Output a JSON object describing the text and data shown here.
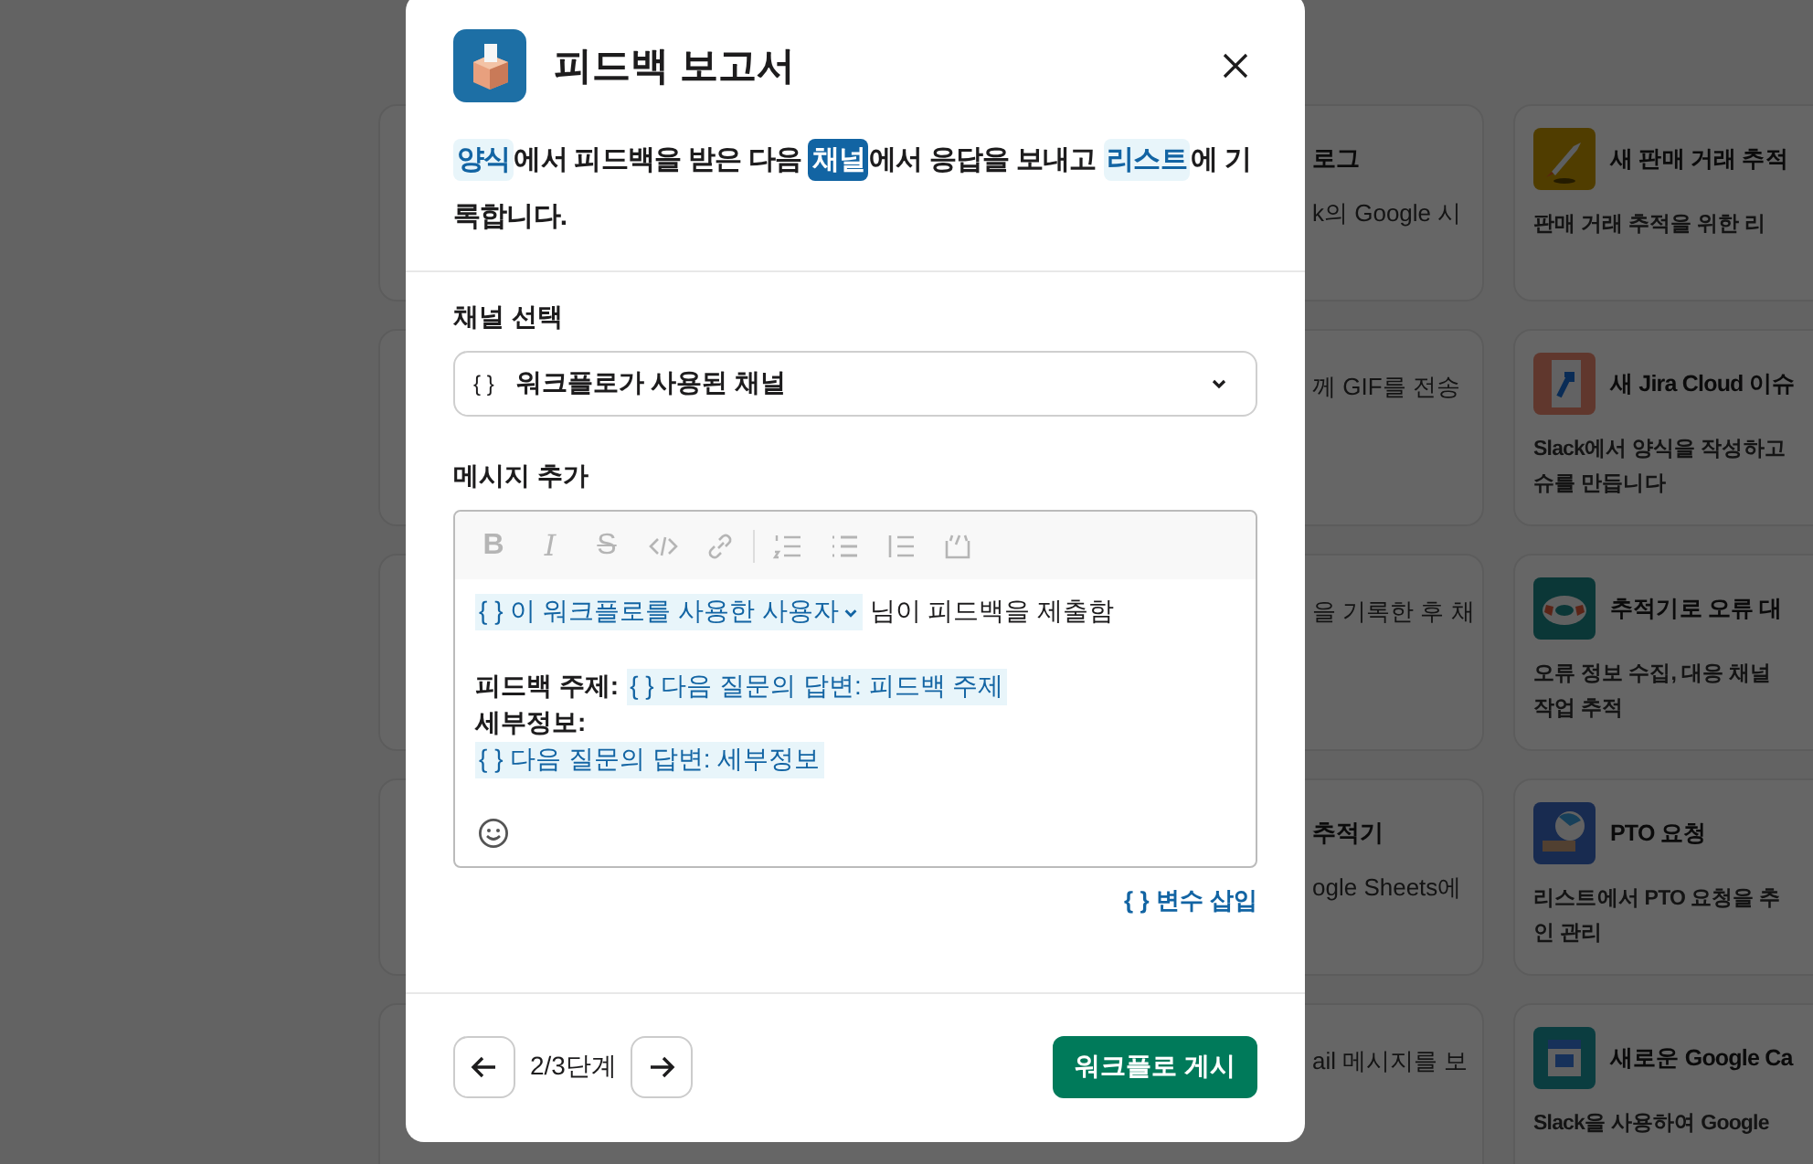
{
  "background_cards": {
    "column_1": [
      {
        "title": "로그",
        "description_lines": [
          "k의 Google 시"
        ]
      },
      {
        "description_lines": [
          "께 GIF를 전송"
        ]
      },
      {
        "description_lines": [
          "을 기록한 후 채"
        ]
      },
      {
        "title": "추적기",
        "description_lines": [
          "ogle Sheets에"
        ]
      },
      {
        "description_lines": [
          "ail 메시지를 보"
        ]
      }
    ],
    "column_2": [
      {
        "title": "새 판매 거래 추적",
        "description_lines": [
          "판매 거래 추적을 위한 리"
        ]
      },
      {
        "title": "새 Jira Cloud 이슈",
        "description_lines": [
          "Slack에서 양식을 작성하고",
          "슈를 만듭니다"
        ]
      },
      {
        "title": "추적기로 오류 대",
        "description_lines": [
          "오류 정보 수집, 대응 채널",
          "작업 추적"
        ]
      },
      {
        "title": "PTO 요청",
        "description_lines": [
          "리스트에서 PTO 요청을 추",
          "인 관리"
        ]
      },
      {
        "title": "새로운 Google Ca",
        "description_lines": [
          "Slack을 사용하여 Google"
        ]
      }
    ]
  },
  "dialog": {
    "title": "피드백 보고서",
    "summary": [
      {
        "kind": "token",
        "text": "양식"
      },
      {
        "kind": "plain",
        "text": "에서 피드백을 받은 다음 "
      },
      {
        "kind": "token_selected",
        "text": "채널"
      },
      {
        "kind": "plain",
        "text": "에서 응답을 보내고 "
      },
      {
        "kind": "token",
        "text": "리스트"
      },
      {
        "kind": "plain",
        "text": "에 기록합니다."
      }
    ],
    "channel_field": {
      "label": "채널 선택",
      "prefix": "{ }",
      "value": "워크플로가 사용된 채널"
    },
    "message_field": {
      "label": "메시지 추가",
      "toolbar": [
        {
          "kind": "bold",
          "glyph": "B"
        },
        {
          "kind": "italic",
          "glyph": "I"
        },
        {
          "kind": "strike",
          "glyph": "S"
        },
        {
          "kind": "code"
        },
        {
          "kind": "link"
        },
        {
          "kind": "divider"
        },
        {
          "kind": "numbered"
        },
        {
          "kind": "bulleted"
        },
        {
          "kind": "quote"
        },
        {
          "kind": "codeblock"
        }
      ],
      "lines": [
        {
          "segments": [
            {
              "kind": "variable",
              "text": "{ } 이 워크플로를 사용한 사용자",
              "dropdown": true
            },
            {
              "kind": "plain",
              "text": "님이 피드백을 제출함"
            }
          ]
        },
        {
          "gap_before": true,
          "segments": [
            {
              "kind": "bold",
              "text": "피드백 주제:"
            },
            {
              "kind": "variable",
              "text": "{ } 다음 질문의 답변: 피드백 주제",
              "dropdown": false
            }
          ]
        },
        {
          "segments": [
            {
              "kind": "bold",
              "text": "세부정보:"
            }
          ]
        },
        {
          "segments": [
            {
              "kind": "variable",
              "text": "{ } 다음 질문의 답변: 세부정보",
              "dropdown": false
            }
          ]
        }
      ]
    },
    "insert_variable": "{ } 변수 삽입",
    "step": "2/3단계",
    "publish_button": "워크플로 게시"
  }
}
